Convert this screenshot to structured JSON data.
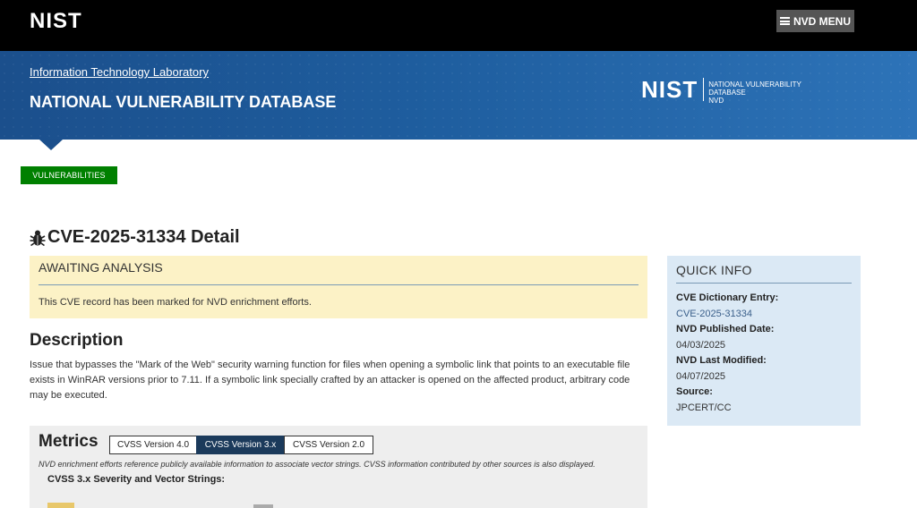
{
  "header": {
    "logo_text": "NIST",
    "menu_button_label": "NVD MENU"
  },
  "banner": {
    "itl_link": "Information Technology Laboratory",
    "title": "NATIONAL VULNERABILITY DATABASE",
    "logo_mark": "NIST",
    "logo_line1": "NATIONAL VULNERABILITY",
    "logo_line2": "DATABASE",
    "logo_line3": "NVD"
  },
  "nav": {
    "vulnerabilities_button": "VULNERABILITIES"
  },
  "cve": {
    "title": "CVE-2025-31334 Detail"
  },
  "status": {
    "title": "AWAITING ANALYSIS",
    "text": "This CVE record has been marked for NVD enrichment efforts."
  },
  "description": {
    "heading": "Description",
    "text": "Issue that bypasses the \"Mark of the Web\" security warning function for files when opening a symbolic link that points to an executable file exists in WinRAR versions prior to 7.11. If a symbolic link specially crafted by an attacker is opened on the affected product, arbitrary code may be executed."
  },
  "metrics": {
    "heading": "Metrics",
    "tabs": [
      {
        "label": "CVSS Version 4.0",
        "active": false
      },
      {
        "label": "CVSS Version 3.x",
        "active": true
      },
      {
        "label": "CVSS Version 2.0",
        "active": false
      }
    ],
    "note": "NVD enrichment efforts reference publicly available information to associate vector strings. CVSS information contributed by other sources is also displayed.",
    "cvss_heading": "CVSS 3.x Severity and Vector Strings:"
  },
  "quick_info": {
    "title": "QUICK INFO",
    "entries": [
      {
        "label": "CVE Dictionary Entry:",
        "value": "CVE-2025-31334",
        "link": true
      },
      {
        "label": "NVD Published Date:",
        "value": "04/03/2025",
        "link": false
      },
      {
        "label": "NVD Last Modified:",
        "value": "04/07/2025",
        "link": false
      },
      {
        "label": "Source:",
        "value": "JPCERT/CC",
        "link": false
      }
    ]
  },
  "colors": {
    "banner_blue": "#1e5d9e",
    "green_button": "#008000",
    "status_bg": "#fcf2c6",
    "quick_info_bg": "#dbe9f5",
    "active_tab": "#1b3a5b"
  }
}
